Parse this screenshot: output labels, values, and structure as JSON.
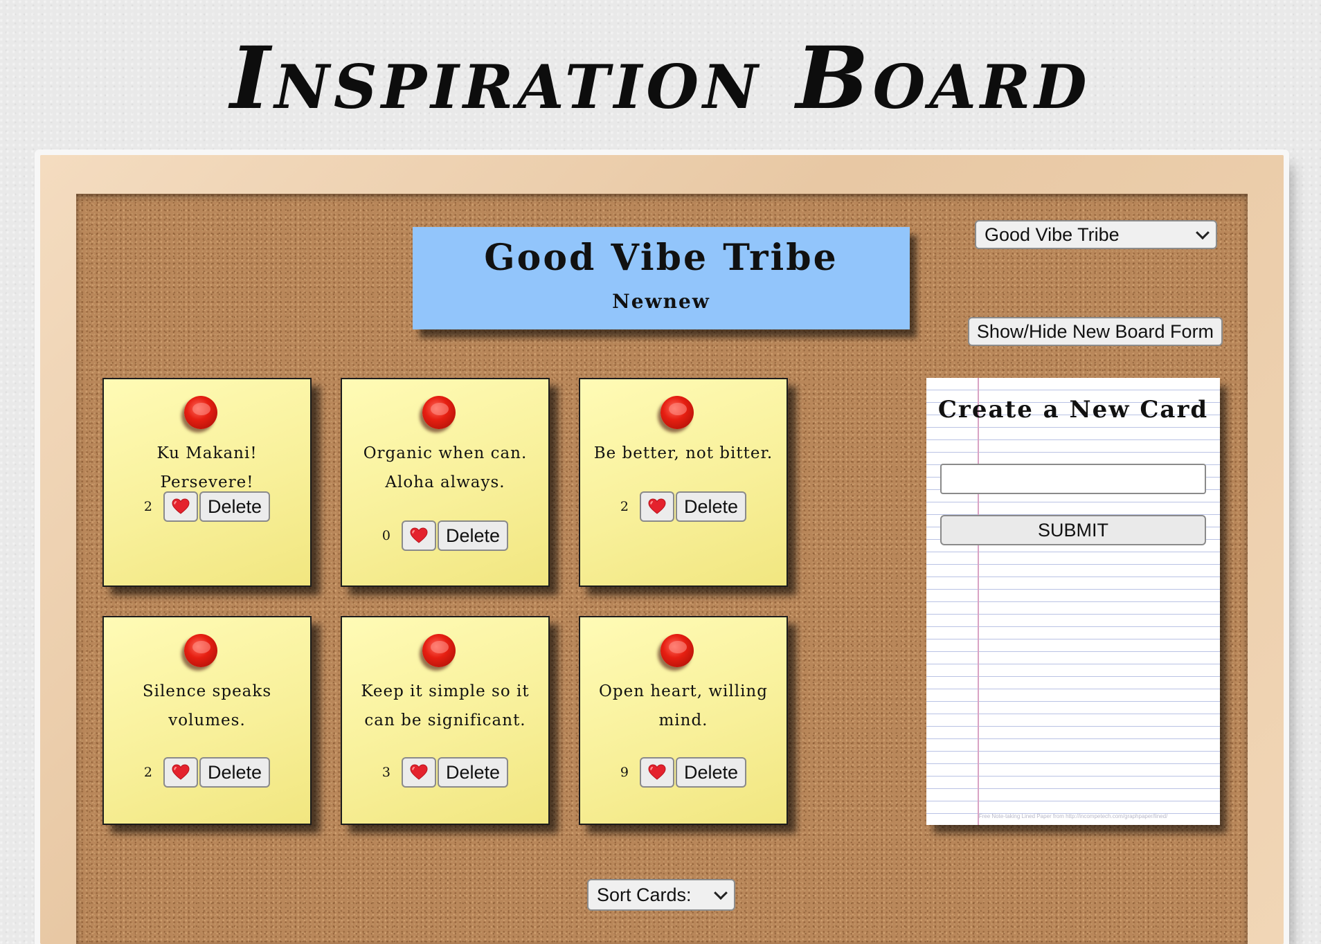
{
  "page": {
    "title": "Inspiration Board"
  },
  "board": {
    "name": "Good Vibe Tribe",
    "owner": "Newnew"
  },
  "board_selector": {
    "selected": "Good Vibe Tribe"
  },
  "toggle_form_label": "Show/Hide New Board Form",
  "cards": [
    {
      "message": "Ku Makani! Persevere!",
      "likes": "2",
      "like_icon": "heart-icon",
      "delete_label": "Delete"
    },
    {
      "message": "Organic when can. Aloha always.",
      "likes": "0",
      "like_icon": "heart-icon",
      "delete_label": "Delete"
    },
    {
      "message": "Be better, not bitter.",
      "likes": "2",
      "like_icon": "heart-icon",
      "delete_label": "Delete"
    },
    {
      "message": "Silence speaks volumes.",
      "likes": "2",
      "like_icon": "heart-icon",
      "delete_label": "Delete"
    },
    {
      "message": "Keep it simple so it can be significant.",
      "likes": "3",
      "like_icon": "heart-icon",
      "delete_label": "Delete"
    },
    {
      "message": "Open heart, willing mind.",
      "likes": "9",
      "like_icon": "heart-icon",
      "delete_label": "Delete"
    }
  ],
  "new_card_form": {
    "title": "Create a New Card",
    "input_value": "",
    "submit_label": "SUBMIT",
    "credit": "Free Note-taking Lined Paper from http://incompetech.com/graphpaper/lined/"
  },
  "sort": {
    "label": "Sort Cards:"
  },
  "colors": {
    "board_header_bg": "#92c5fb",
    "note_bg": "#f8f09a",
    "pin_red": "#e61f12",
    "cork": "#b9875a"
  }
}
